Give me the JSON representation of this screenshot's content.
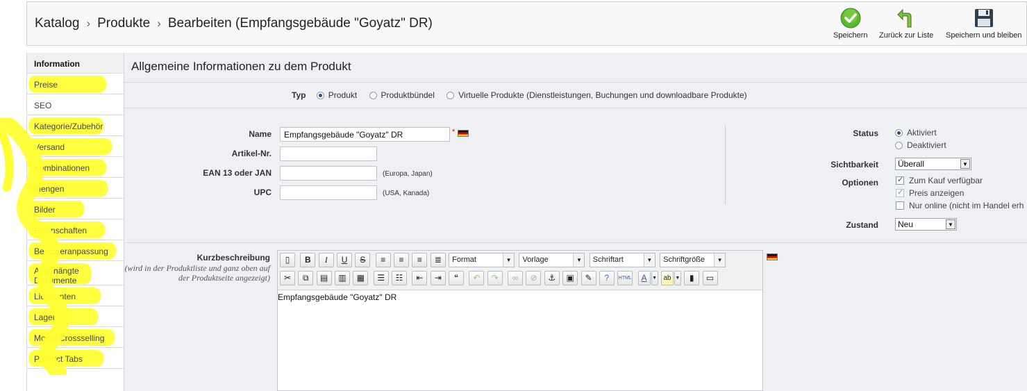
{
  "header": {
    "breadcrumb": [
      "Katalog",
      "Produkte",
      "Bearbeiten (Empfangsgebäude \"Goyatz\" DR)"
    ],
    "separator": ">",
    "toolbar": {
      "save_label": "Speichern",
      "back_label": "Zurück zur Liste",
      "save_stay_label": "Speichern und bleiben"
    }
  },
  "sidebar": {
    "items": [
      {
        "label": "Information"
      },
      {
        "label": "Preise"
      },
      {
        "label": "SEO"
      },
      {
        "label": "Kategorie/Zubehör"
      },
      {
        "label": "Versand"
      },
      {
        "label": "Kombinationen"
      },
      {
        "label": "Mengen"
      },
      {
        "label": "Bilder"
      },
      {
        "label": "Eigenschaften"
      },
      {
        "label": "Benutzeranpassung"
      },
      {
        "label": "Angehängte Dokumente"
      },
      {
        "label": "Lieferanten"
      },
      {
        "label": "Lager"
      },
      {
        "label": "Modal Crossselling"
      },
      {
        "label": "Product Tabs"
      }
    ]
  },
  "main": {
    "title": "Allgemeine Informationen zu dem Produkt",
    "type": {
      "label": "Typ",
      "options": [
        "Produkt",
        "Produktbündel",
        "Virtuelle Produkte (Dienstleistungen, Buchungen und downloadbare Produkte)"
      ],
      "selected": "Produkt"
    },
    "fields": {
      "name_label": "Name",
      "name_value": "Empfangsgebäude \"Goyatz\" DR",
      "required_mark": "*",
      "sku_label": "Artikel-Nr.",
      "sku_value": "",
      "ean_label": "EAN 13 oder JAN",
      "ean_value": "",
      "ean_hint": "(Europa, Japan)",
      "upc_label": "UPC",
      "upc_value": "",
      "upc_hint": "(USA, Kanada)"
    },
    "status": {
      "label": "Status",
      "options": [
        "Aktiviert",
        "Deaktiviert"
      ],
      "selected": "Aktiviert"
    },
    "visibility": {
      "label": "Sichtbarkeit",
      "value": "Überall"
    },
    "options": {
      "label": "Optionen",
      "items": [
        {
          "label": "Zum Kauf verfügbar",
          "checked": true
        },
        {
          "label": "Preis anzeigen",
          "checked": true
        },
        {
          "label": "Nur online (nicht im Handel erh",
          "checked": false
        }
      ]
    },
    "condition": {
      "label": "Zustand",
      "value": "Neu"
    },
    "short_description": {
      "label": "Kurzbeschreibung",
      "sublabel": "(wird in der Produktliste und ganz oben auf der Produktseite angezeigt)",
      "content": "Empfangsgebäude \"Goyatz\" DR",
      "toolbar": {
        "format": "Format",
        "template": "Vorlage",
        "font": "Schriftart",
        "size": "Schriftgröße"
      }
    }
  },
  "colors": {
    "highlight": "#ffff33",
    "accent": "#2a4e7f",
    "background": "#eef0f3"
  }
}
